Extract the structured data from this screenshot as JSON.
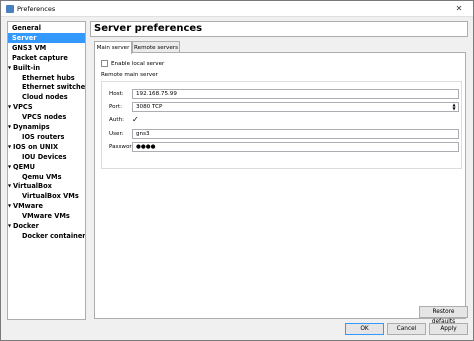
{
  "window": {
    "title": "Preferences",
    "close_glyph": "✕",
    "app_icon": "gns3-icon"
  },
  "sidebar": {
    "items": [
      {
        "label": "General",
        "level": 0,
        "expandable": false,
        "selected": false
      },
      {
        "label": "Server",
        "level": 0,
        "expandable": false,
        "selected": true
      },
      {
        "label": "GNS3 VM",
        "level": 0,
        "expandable": false,
        "selected": false
      },
      {
        "label": "Packet capture",
        "level": 0,
        "expandable": false,
        "selected": false
      },
      {
        "label": "Built-in",
        "level": 0,
        "expandable": true,
        "selected": false
      },
      {
        "label": "Ethernet hubs",
        "level": 1,
        "expandable": false,
        "selected": false
      },
      {
        "label": "Ethernet switches",
        "level": 1,
        "expandable": false,
        "selected": false
      },
      {
        "label": "Cloud nodes",
        "level": 1,
        "expandable": false,
        "selected": false
      },
      {
        "label": "VPCS",
        "level": 0,
        "expandable": true,
        "selected": false
      },
      {
        "label": "VPCS nodes",
        "level": 1,
        "expandable": false,
        "selected": false
      },
      {
        "label": "Dynamips",
        "level": 0,
        "expandable": true,
        "selected": false
      },
      {
        "label": "IOS routers",
        "level": 1,
        "expandable": false,
        "selected": false
      },
      {
        "label": "IOS on UNIX",
        "level": 0,
        "expandable": true,
        "selected": false
      },
      {
        "label": "IOU Devices",
        "level": 1,
        "expandable": false,
        "selected": false
      },
      {
        "label": "QEMU",
        "level": 0,
        "expandable": true,
        "selected": false
      },
      {
        "label": "Qemu VMs",
        "level": 1,
        "expandable": false,
        "selected": false
      },
      {
        "label": "VirtualBox",
        "level": 0,
        "expandable": true,
        "selected": false
      },
      {
        "label": "VirtualBox VMs",
        "level": 1,
        "expandable": false,
        "selected": false
      },
      {
        "label": "VMware",
        "level": 0,
        "expandable": true,
        "selected": false
      },
      {
        "label": "VMware VMs",
        "level": 1,
        "expandable": false,
        "selected": false
      },
      {
        "label": "Docker",
        "level": 0,
        "expandable": true,
        "selected": false
      },
      {
        "label": "Docker containers",
        "level": 1,
        "expandable": false,
        "selected": false
      }
    ]
  },
  "main": {
    "title": "Server preferences",
    "tabs": [
      {
        "label": "Main server",
        "active": true
      },
      {
        "label": "Remote servers",
        "active": false
      }
    ],
    "enable_local_label": "Enable local server",
    "enable_local_checked": false,
    "group_label": "Remote main server",
    "host_label": "Host:",
    "host_value": "192.168.75.99",
    "port_label": "Port:",
    "port_value": "3080 TCP",
    "auth_label": "Auth:",
    "auth_checked": true,
    "user_label": "User:",
    "user_value": "gns3",
    "password_label": "Password:",
    "password_value": "●●●●"
  },
  "buttons": {
    "restore": "Restore defaults",
    "ok": "OK",
    "cancel": "Cancel",
    "apply": "Apply"
  },
  "colors": {
    "selection": "#3399ff",
    "window_bg": "#f0f0f0"
  }
}
